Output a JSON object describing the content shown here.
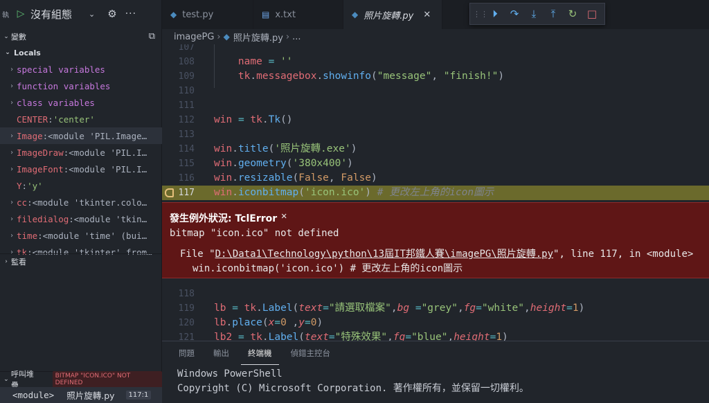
{
  "debug": {
    "cut_label": "執",
    "config_name": "沒有組態"
  },
  "variables": {
    "title": "變數",
    "locals_label": "Locals",
    "items": [
      {
        "name": "special variables",
        "value": "",
        "expandable": true,
        "kind": "scope"
      },
      {
        "name": "function variables",
        "value": "",
        "expandable": true,
        "kind": "scope"
      },
      {
        "name": "class variables",
        "value": "",
        "expandable": true,
        "kind": "scope"
      },
      {
        "name": "CENTER",
        "value": "'center'",
        "expandable": false,
        "kind": "str"
      },
      {
        "name": "Image",
        "value": "<module 'PIL.Image…",
        "expandable": true,
        "kind": "obj",
        "selected": true
      },
      {
        "name": "ImageDraw",
        "value": "<module 'PIL.I…",
        "expandable": true,
        "kind": "obj"
      },
      {
        "name": "ImageFont",
        "value": "<module 'PIL.I…",
        "expandable": true,
        "kind": "obj"
      },
      {
        "name": "Y",
        "value": "'y'",
        "expandable": false,
        "kind": "str"
      },
      {
        "name": "cc",
        "value": "<module 'tkinter.colo…",
        "expandable": true,
        "kind": "obj"
      },
      {
        "name": "filedialog",
        "value": "<module 'tkin…",
        "expandable": true,
        "kind": "obj"
      },
      {
        "name": "time",
        "value": "<module 'time' (bui…",
        "expandable": true,
        "kind": "obj"
      },
      {
        "name": "tk",
        "value": "<module 'tkinter' from…",
        "expandable": true,
        "kind": "obj"
      }
    ]
  },
  "watch": {
    "title": "監看"
  },
  "callstack": {
    "title": "呼叫堆疊",
    "badge": "BITMAP \"ICON.ICO\" NOT DEFINED",
    "frame_fn": "<module>",
    "frame_file": "照片旋轉.py",
    "frame_pos": "117:1"
  },
  "tabs": [
    {
      "label": "test.py",
      "icon": "python-icon",
      "active": false
    },
    {
      "label": "x.txt",
      "icon": "text-file-icon",
      "active": false
    },
    {
      "label": "照片旋轉.py",
      "icon": "python-icon",
      "active": true
    }
  ],
  "breadcrumb": {
    "folder": "imagePG",
    "file": "照片旋轉.py",
    "more": "..."
  },
  "editor": {
    "lines_top": [
      {
        "n": "107",
        "tokens": []
      },
      {
        "n": "108",
        "tokens": [
          [
            "pl",
            "    "
          ],
          [
            "var",
            "name"
          ],
          [
            "pl",
            " "
          ],
          [
            "op",
            "="
          ],
          [
            "pl",
            " "
          ],
          [
            "str",
            "''"
          ]
        ]
      },
      {
        "n": "109",
        "tokens": [
          [
            "pl",
            "    "
          ],
          [
            "var",
            "tk"
          ],
          [
            "pl",
            "."
          ],
          [
            "var",
            "messagebox"
          ],
          [
            "pl",
            "."
          ],
          [
            "fn",
            "showinfo"
          ],
          [
            "pl",
            "("
          ],
          [
            "str",
            "\"message\""
          ],
          [
            "pl",
            ", "
          ],
          [
            "str",
            "\"finish!\""
          ],
          [
            "pl",
            ")"
          ]
        ]
      },
      {
        "n": "110",
        "tokens": []
      },
      {
        "n": "111",
        "tokens": []
      },
      {
        "n": "112",
        "tokens": [
          [
            "var",
            "win"
          ],
          [
            "pl",
            " "
          ],
          [
            "op",
            "="
          ],
          [
            "pl",
            " "
          ],
          [
            "var",
            "tk"
          ],
          [
            "pl",
            "."
          ],
          [
            "fn",
            "Tk"
          ],
          [
            "pl",
            "()"
          ]
        ]
      },
      {
        "n": "113",
        "tokens": []
      },
      {
        "n": "114",
        "tokens": [
          [
            "var",
            "win"
          ],
          [
            "pl",
            "."
          ],
          [
            "fn",
            "title"
          ],
          [
            "pl",
            "("
          ],
          [
            "str",
            "'照片旋轉.exe'"
          ],
          [
            "pl",
            ")"
          ]
        ]
      },
      {
        "n": "115",
        "tokens": [
          [
            "var",
            "win"
          ],
          [
            "pl",
            "."
          ],
          [
            "fn",
            "geometry"
          ],
          [
            "pl",
            "("
          ],
          [
            "str",
            "'380x400'"
          ],
          [
            "pl",
            ")"
          ]
        ]
      },
      {
        "n": "116",
        "tokens": [
          [
            "var",
            "win"
          ],
          [
            "pl",
            "."
          ],
          [
            "fn",
            "resizable"
          ],
          [
            "pl",
            "("
          ],
          [
            "num",
            "False"
          ],
          [
            "pl",
            ", "
          ],
          [
            "num",
            "False"
          ],
          [
            "pl",
            ")"
          ]
        ]
      },
      {
        "n": "117",
        "tokens": [
          [
            "var",
            "win"
          ],
          [
            "pl",
            "."
          ],
          [
            "fn",
            "iconbitmap"
          ],
          [
            "pl",
            "("
          ],
          [
            "str",
            "'icon.ico'"
          ],
          [
            "pl",
            ") "
          ],
          [
            "cmt",
            "# 更改左上角的icon圖示"
          ]
        ],
        "current": true
      }
    ],
    "lines_bottom": [
      {
        "n": "118",
        "tokens": []
      },
      {
        "n": "119",
        "tokens": [
          [
            "var",
            "lb"
          ],
          [
            "pl",
            " "
          ],
          [
            "op",
            "="
          ],
          [
            "pl",
            " "
          ],
          [
            "var",
            "tk"
          ],
          [
            "pl",
            "."
          ],
          [
            "fn",
            "Label"
          ],
          [
            "pl",
            "("
          ],
          [
            "prm",
            "text"
          ],
          [
            "op",
            "="
          ],
          [
            "str",
            "\"請選取檔案\""
          ],
          [
            "pl",
            ","
          ],
          [
            "prm",
            "bg"
          ],
          [
            "pl",
            " "
          ],
          [
            "op",
            "="
          ],
          [
            "str",
            "\"grey\""
          ],
          [
            "pl",
            ","
          ],
          [
            "prm",
            "fg"
          ],
          [
            "op",
            "="
          ],
          [
            "str",
            "\"white\""
          ],
          [
            "pl",
            ","
          ],
          [
            "prm",
            "height"
          ],
          [
            "op",
            "="
          ],
          [
            "num",
            "1"
          ],
          [
            "pl",
            ")"
          ]
        ]
      },
      {
        "n": "120",
        "tokens": [
          [
            "var",
            "lb"
          ],
          [
            "pl",
            "."
          ],
          [
            "fn",
            "place"
          ],
          [
            "pl",
            "("
          ],
          [
            "prm",
            "x"
          ],
          [
            "op",
            "="
          ],
          [
            "num",
            "0"
          ],
          [
            "pl",
            " ,"
          ],
          [
            "prm",
            "y"
          ],
          [
            "op",
            "="
          ],
          [
            "num",
            "0"
          ],
          [
            "pl",
            ")"
          ]
        ]
      },
      {
        "n": "121",
        "tokens": [
          [
            "var",
            "lb2"
          ],
          [
            "pl",
            " "
          ],
          [
            "op",
            "="
          ],
          [
            "pl",
            " "
          ],
          [
            "var",
            "tk"
          ],
          [
            "pl",
            "."
          ],
          [
            "fn",
            "Label"
          ],
          [
            "pl",
            "("
          ],
          [
            "prm",
            "text"
          ],
          [
            "op",
            "="
          ],
          [
            "str",
            "\"特殊效果\""
          ],
          [
            "pl",
            ","
          ],
          [
            "prm",
            "fg"
          ],
          [
            "op",
            "="
          ],
          [
            "str",
            "\"blue\""
          ],
          [
            "pl",
            ","
          ],
          [
            "prm",
            "height"
          ],
          [
            "op",
            "="
          ],
          [
            "num",
            "1"
          ],
          [
            "pl",
            ")"
          ]
        ]
      }
    ]
  },
  "exception": {
    "title": "發生例外狀況: TclError",
    "message": "bitmap \"icon.ico\" not defined",
    "trace_prefix": "File \"",
    "trace_path": "D:\\Data1\\Technology\\python\\13屆IT邦鐵人賽\\imagePG\\照片旋轉.py",
    "trace_suffix": "\", line 117, in <module>",
    "trace_code": "win.iconbitmap('icon.ico') # 更改左上角的icon圖示"
  },
  "panel": {
    "tabs": [
      "問題",
      "輸出",
      "終端機",
      "偵錯主控台"
    ],
    "active_tab": 2,
    "terminal_lines": [
      "Windows PowerShell",
      "Copyright (C) Microsoft Corporation. 著作權所有，並保留一切權利。"
    ]
  },
  "colors": {
    "exception_bg": "#5f1616",
    "current_line_bg": "#6b6a2c",
    "debug_blue": "#61afef",
    "debug_green": "#98c379",
    "debug_red": "#e06c75"
  }
}
